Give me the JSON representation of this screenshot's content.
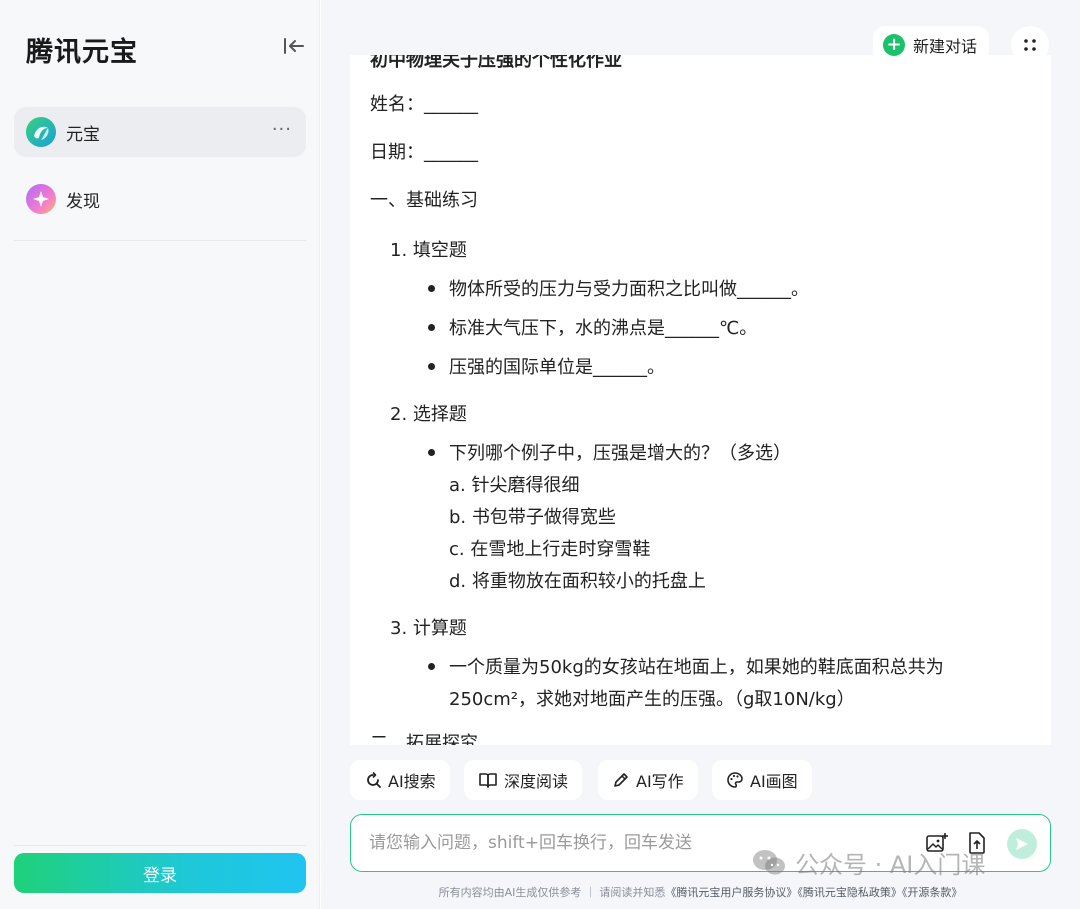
{
  "sidebar": {
    "brand": "腾讯元宝",
    "items": [
      {
        "label": "元宝",
        "icon": "yuanbao-logo-icon",
        "active": true
      },
      {
        "label": "发现",
        "icon": "sparkle-icon",
        "active": false
      }
    ],
    "more_label": "···",
    "login_label": "登录"
  },
  "header": {
    "new_chat_label": "新建对话"
  },
  "document": {
    "title": "初中物理关于压强的个性化作业",
    "name_line": "姓名：______",
    "date_line": "日期：______",
    "section1": "一、基础练习",
    "q1_title": "1. 填空题",
    "q1_items": [
      "物体所受的压力与受力面积之比叫做______。",
      "标准大气压下，水的沸点是______℃。",
      "压强的国际单位是______。"
    ],
    "q2_title": "2. 选择题",
    "q2_stem": "下列哪个例子中，压强是增大的？（多选）",
    "q2_options": [
      "a. 针尖磨得很细",
      "b. 书包带子做得宽些",
      "c. 在雪地上行走时穿雪鞋",
      "d. 将重物放在面积较小的托盘上"
    ],
    "q3_title": "3. 计算题",
    "q3_line1": "一个质量为50kg的女孩站在地面上，如果她的鞋底面积总共为",
    "q3_line2": "250cm²，求她对地面产生的压强。（g取10N/kg）",
    "section2": "二、拓展探究"
  },
  "quick_actions": [
    {
      "label": "AI搜索",
      "icon": "search-refresh-icon"
    },
    {
      "label": "深度阅读",
      "icon": "book-open-icon"
    },
    {
      "label": "AI写作",
      "icon": "pen-icon"
    },
    {
      "label": "AI画图",
      "icon": "palette-icon"
    }
  ],
  "input": {
    "placeholder": "请您输入问题，shift+回车换行，回车发送"
  },
  "footer": {
    "disclaimer": "所有内容均由AI生成仅供参考 ｜ 请阅读并知悉",
    "link1": "《腾讯元宝用户服务协议》",
    "link2": "《腾讯元宝隐私政策》",
    "link3": "《开源条款》"
  },
  "watermark": {
    "text": "公众号 · AI入门课"
  },
  "colors": {
    "accent_green": "#19c26b",
    "input_border": "#26c98a",
    "login_gradient_start": "#1fd17a",
    "login_gradient_end": "#20c4f0"
  }
}
